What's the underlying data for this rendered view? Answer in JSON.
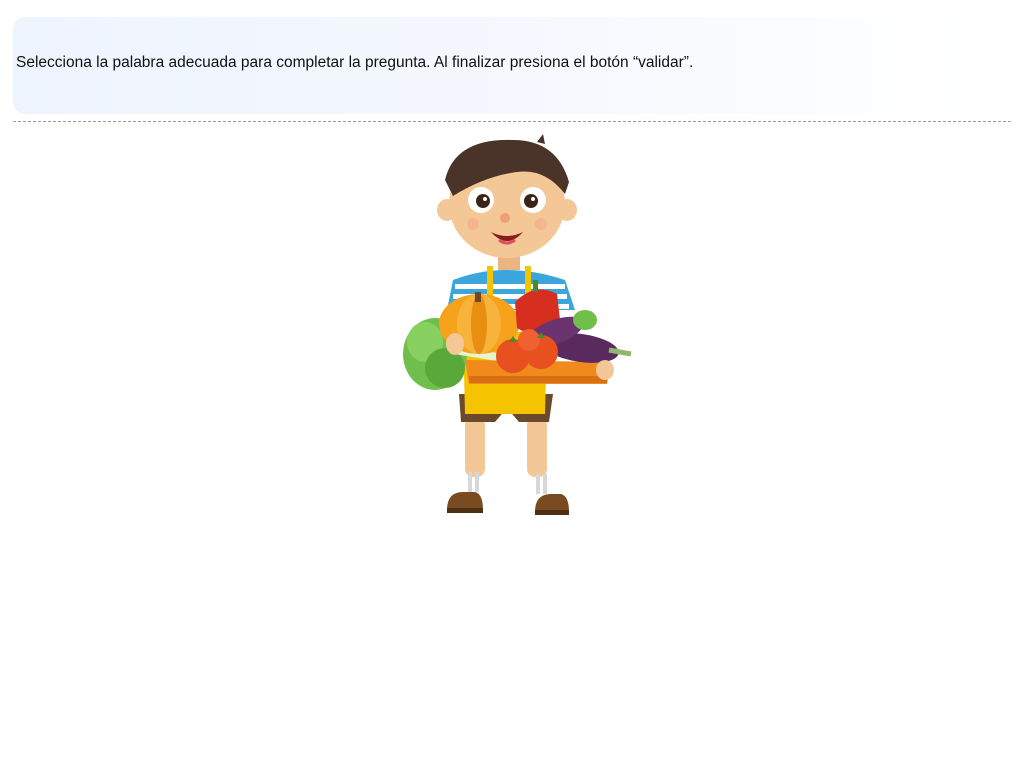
{
  "instruction": {
    "text": "Selecciona la palabra adecuada para completar la pregunta. Al finalizar presiona el botón “validar”."
  },
  "illustration": {
    "subject": "boy-holding-vegetable-crate",
    "colors": {
      "skin": "#f3c896",
      "hair": "#4a3328",
      "shirt_stripe_a": "#3aa6dc",
      "shirt_stripe_b": "#ffffff",
      "apron": "#f5c400",
      "shorts": "#6b4a2b",
      "shoes": "#7a4b20",
      "crate": "#f08a1c",
      "pumpkin": "#f6a21a",
      "pepper": "#d62e1f",
      "tomato": "#e8501f",
      "eggplant": "#5a2a5e",
      "lettuce": "#6fbf4a"
    }
  }
}
